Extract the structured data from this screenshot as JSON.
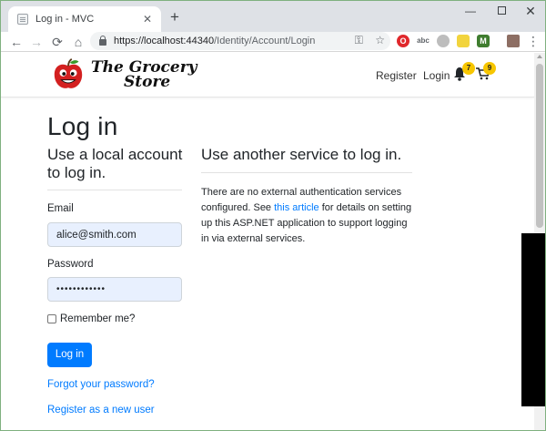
{
  "browser": {
    "tab_title": "Log in - MVC",
    "tab_close": "✕",
    "new_tab": "+",
    "minimize": "—",
    "close": "✕",
    "back": "←",
    "forward": "→",
    "reload": "⟳",
    "home": "⌂",
    "url_host": "https://localhost:44340",
    "url_path": "/Identity/Account/Login",
    "key_icon": "⚿",
    "star_icon": "☆",
    "menu": "⋮",
    "ext_labels": [
      "O",
      "abc",
      "",
      "",
      "M",
      ""
    ]
  },
  "navbar": {
    "brand_line1": "The Grocery",
    "brand_line2": "Store",
    "register": "Register",
    "login": "Login",
    "notifications_count": "7",
    "cart_count": "9"
  },
  "main": {
    "title": "Log in",
    "local_heading": "Use a local account to log in.",
    "email_label": "Email",
    "email_value": "alice@smith.com",
    "password_label": "Password",
    "password_value": "••••••••••••",
    "remember_label": "Remember me?",
    "login_button": "Log in",
    "forgot_link": "Forgot your password?",
    "register_link": "Register as a new user"
  },
  "external": {
    "heading": "Use another service to log in.",
    "text_before": "There are no external authentication services configured. See ",
    "link_text": "this article",
    "text_after": " for details on setting up this ASP.NET application to support logging in via external services."
  },
  "colors": {
    "primary": "#007bff",
    "badge": "#f7c600",
    "input_bg": "#e8f0fe"
  }
}
